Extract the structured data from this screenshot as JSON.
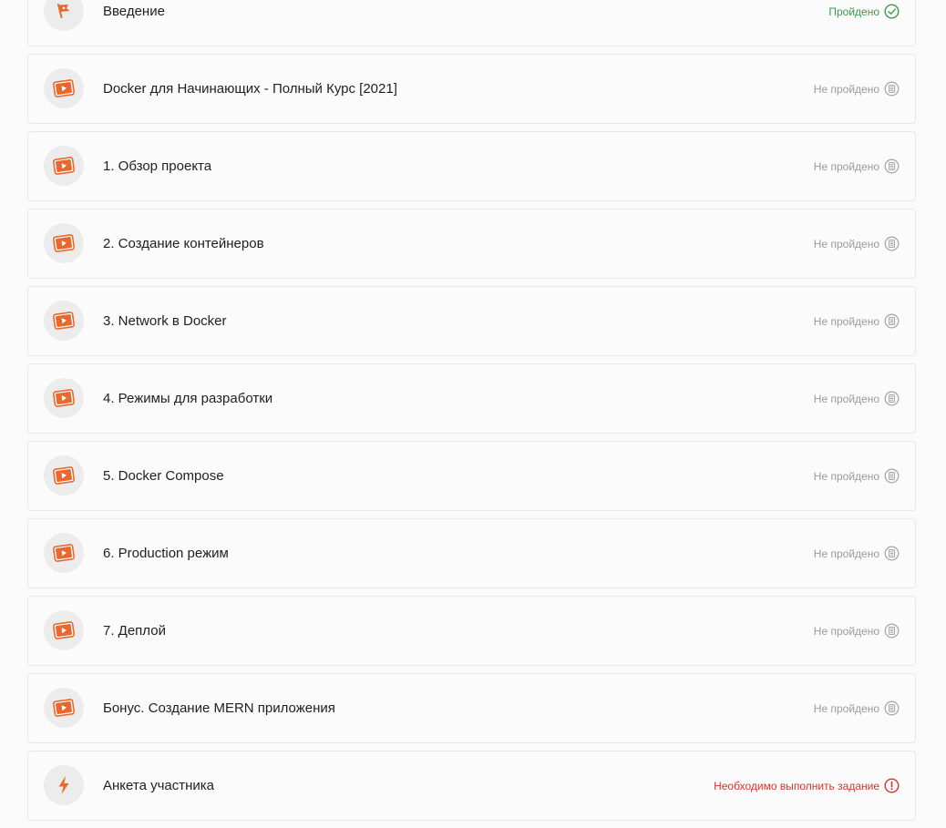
{
  "lessons": [
    {
      "title": "Введение",
      "status": "Пройдено",
      "state": "passed",
      "icon": "flag-icon"
    },
    {
      "title": "Docker для Начинающих - Полный Курс [2021]",
      "status": "Не пройдено",
      "state": "pending",
      "icon": "video-icon"
    },
    {
      "title": "1. Обзор проекта",
      "status": "Не пройдено",
      "state": "pending",
      "icon": "video-icon"
    },
    {
      "title": "2. Создание контейнеров",
      "status": "Не пройдено",
      "state": "pending",
      "icon": "video-icon"
    },
    {
      "title": "3. Network в Docker",
      "status": "Не пройдено",
      "state": "pending",
      "icon": "video-icon"
    },
    {
      "title": "4. Режимы для разработки",
      "status": "Не пройдено",
      "state": "pending",
      "icon": "video-icon"
    },
    {
      "title": "5. Docker Compose",
      "status": "Не пройдено",
      "state": "pending",
      "icon": "video-icon"
    },
    {
      "title": "6. Production режим",
      "status": "Не пройдено",
      "state": "pending",
      "icon": "video-icon"
    },
    {
      "title": "7. Деплой",
      "status": "Не пройдено",
      "state": "pending",
      "icon": "video-icon"
    },
    {
      "title": "Бонус. Создание MERN приложения",
      "status": "Не пройдено",
      "state": "pending",
      "icon": "video-icon"
    },
    {
      "title": "Анкета участника",
      "status": "Необходимо выполнить задание",
      "state": "required",
      "icon": "lightning-icon"
    }
  ],
  "colors": {
    "accent": "#e8692f",
    "passed": "#3a9a4c",
    "pending": "#9a9a9a",
    "required": "#d9332a"
  }
}
